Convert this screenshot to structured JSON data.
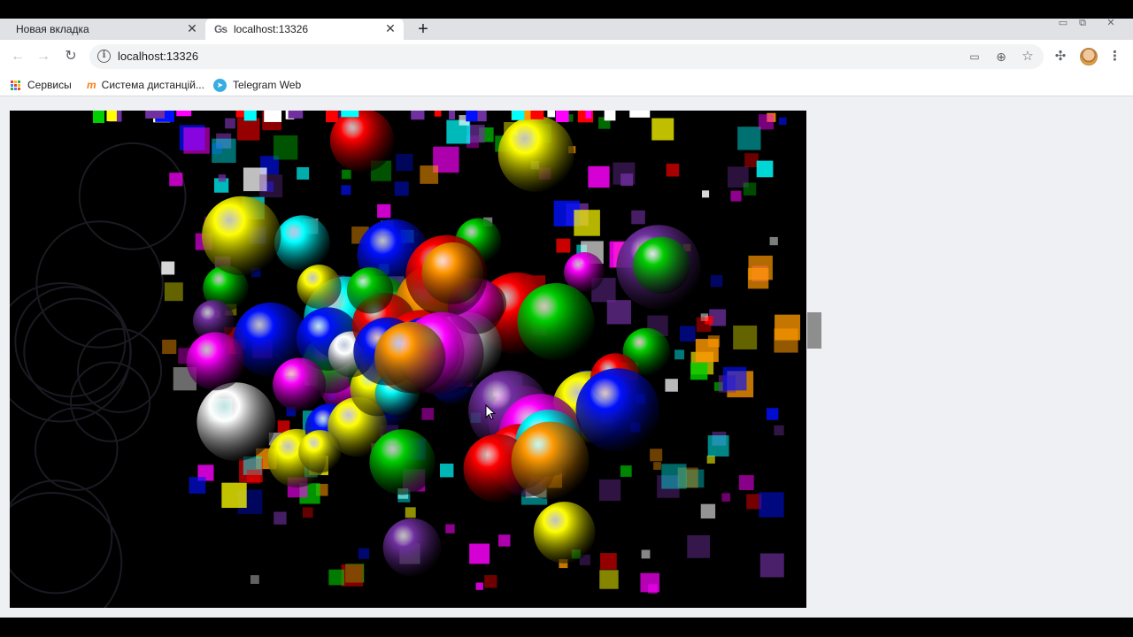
{
  "browser": {
    "tabs": [
      {
        "label": "Новая вкладка",
        "active": false
      },
      {
        "label": "localhost:13326",
        "active": true,
        "favicon_text": "Gs"
      }
    ],
    "omnibox": {
      "url": "localhost:13326"
    },
    "bookmarks": [
      {
        "label": "Сервисы",
        "icon": "apps-grid-icon"
      },
      {
        "label": "Система дистанцій...",
        "icon": "moodle-icon"
      },
      {
        "label": "Telegram Web",
        "icon": "telegram-icon"
      }
    ],
    "icons": {
      "back": "back-arrow-icon",
      "forward": "forward-arrow-icon",
      "reload": "reload-icon",
      "site_info": "info-icon",
      "cast": "cast-icon",
      "zoom": "zoom-icon",
      "bookmark_star": "star-icon",
      "extensions": "puzzle-icon",
      "menu": "kebab-menu-icon"
    }
  },
  "page": {
    "scene": "multicolored glossy balloons rendered in canvas with blocky artifacts",
    "colors": {
      "page_background": "#eef0f4",
      "canvas_background": "#000000",
      "balloon_palette": [
        "#ff0000",
        "#00d000",
        "#0010ff",
        "#ffff00",
        "#ff00ff",
        "#ff9900",
        "#7030a0",
        "#ffffff",
        "#00ffff"
      ]
    }
  }
}
